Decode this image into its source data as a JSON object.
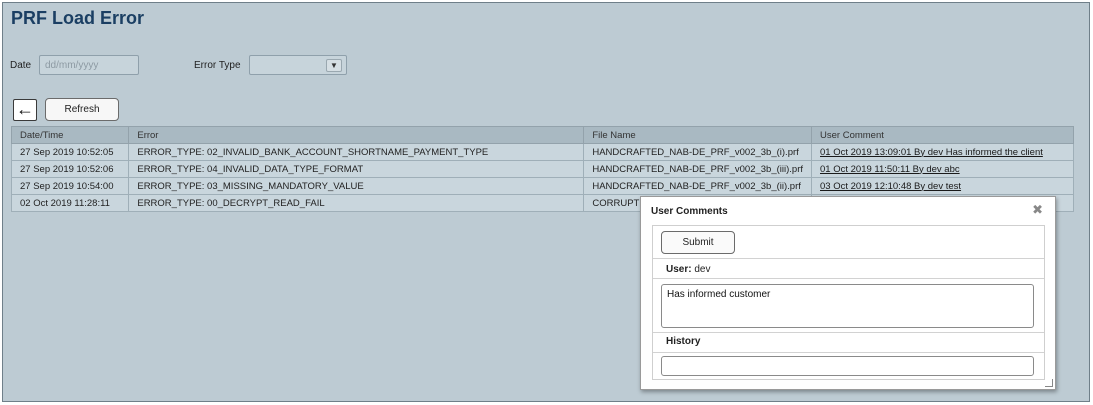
{
  "page": {
    "title": "PRF Load Error"
  },
  "filters": {
    "date_label": "Date",
    "date_placeholder": "dd/mm/yyyy",
    "error_type_label": "Error Type",
    "error_type_value": ""
  },
  "toolbar": {
    "back_glyph": "←",
    "refresh_label": "Refresh"
  },
  "table": {
    "headers": [
      "Date/Time",
      "Error",
      "File Name",
      "User Comment"
    ],
    "rows": [
      {
        "datetime": "27 Sep 2019 10:52:05",
        "error": "ERROR_TYPE: 02_INVALID_BANK_ACCOUNT_SHORTNAME_PAYMENT_TYPE",
        "file": "HANDCRAFTED_NAB-DE_PRF_v002_3b_(i).prf",
        "comment": "01 Oct 2019 13:09:01 By dev Has informed the client"
      },
      {
        "datetime": "27 Sep 2019 10:52:06",
        "error": "ERROR_TYPE: 04_INVALID_DATA_TYPE_FORMAT",
        "file": "HANDCRAFTED_NAB-DE_PRF_v002_3b_(iii).prf",
        "comment": "01 Oct 2019 11:50:11 By dev abc"
      },
      {
        "datetime": "27 Sep 2019 10:54:00",
        "error": "ERROR_TYPE: 03_MISSING_MANDATORY_VALUE",
        "file": "HANDCRAFTED_NAB-DE_PRF_v002_3b_(ii).prf",
        "comment": "03 Oct 2019 12:10:48 By dev test"
      },
      {
        "datetime": "02 Oct 2019 11:28:11",
        "error": "ERROR_TYPE: 00_DECRYPT_READ_FAIL",
        "file": "CORRUPT",
        "comment": ""
      }
    ]
  },
  "modal": {
    "title": "User Comments",
    "close_glyph": "✖",
    "submit_label": "Submit",
    "user_label": "User:",
    "user_value": "dev",
    "comment_value": "Has informed customer",
    "history_label": "History"
  }
}
